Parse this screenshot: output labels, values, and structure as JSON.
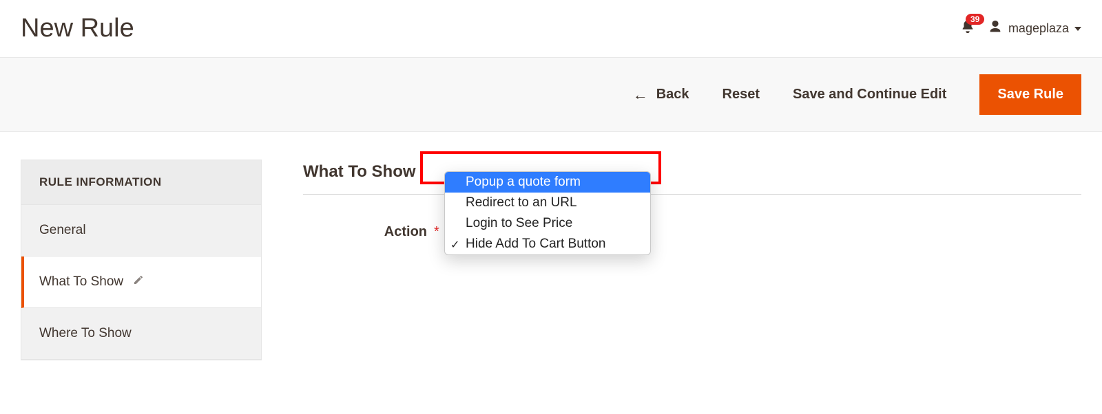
{
  "header": {
    "title": "New Rule",
    "notif_count": "39",
    "username": "mageplaza"
  },
  "toolbar": {
    "back": "Back",
    "reset": "Reset",
    "save_continue": "Save and Continue Edit",
    "save": "Save Rule"
  },
  "sidebar": {
    "title": "RULE INFORMATION",
    "tabs": {
      "general": "General",
      "what_to_show": "What To Show",
      "where_to_show": "Where To Show"
    }
  },
  "form": {
    "section_title": "What To Show",
    "action_label": "Action",
    "dropdown": {
      "opt1": "Popup a quote form",
      "opt2": "Redirect to an URL",
      "opt3": "Login to See Price",
      "opt4": "Hide Add To Cart Button"
    }
  }
}
